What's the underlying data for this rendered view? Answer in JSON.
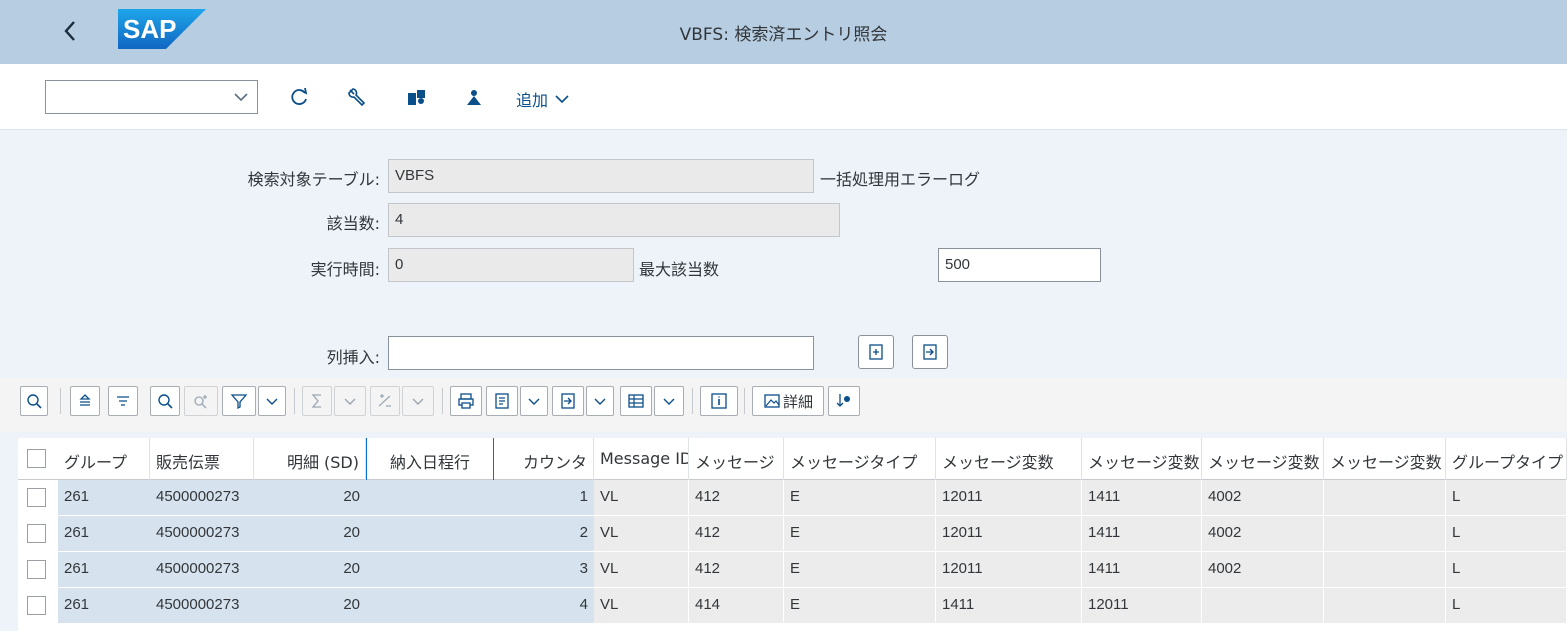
{
  "shell": {
    "title": "VBFS: 検索済エントリ照会",
    "logo_text": "SAP",
    "brand_color": "#1b74c8"
  },
  "toolbar": {
    "command_value": "",
    "icons": [
      "refresh-icon",
      "wrench-icon",
      "puzzle-icon",
      "person-icon"
    ],
    "more_label": "追加"
  },
  "form": {
    "table_label": "検索対象テーブル:",
    "table_value": "VBFS",
    "table_desc": "一括処理用エラーログ",
    "hits_label": "該当数:",
    "hits_value": "4",
    "runtime_label": "実行時間:",
    "runtime_value": "0",
    "max_hits_label": "最大該当数",
    "max_hits_value": "500",
    "insert_col_label": "列挿入:",
    "insert_col_value": ""
  },
  "alv": {
    "details_label": "詳細"
  },
  "grid": {
    "columns": [
      "グループ",
      "販売伝票",
      "明細 (SD)",
      "納入日程行",
      "カウンタ",
      "Message ID",
      "メッセージ",
      "メッセージタイプ",
      "メッセージ変数",
      "メッセージ変数",
      "メッセージ変数",
      "メッセージ変数",
      "グループタイプ"
    ],
    "rows": [
      [
        "261",
        "4500000273",
        "20",
        "",
        "1",
        "VL",
        "412",
        "E",
        "12011",
        "1411",
        "4002",
        "",
        "L"
      ],
      [
        "261",
        "4500000273",
        "20",
        "",
        "2",
        "VL",
        "412",
        "E",
        "12011",
        "1411",
        "4002",
        "",
        "L"
      ],
      [
        "261",
        "4500000273",
        "20",
        "",
        "3",
        "VL",
        "412",
        "E",
        "12011",
        "1411",
        "4002",
        "",
        "L"
      ],
      [
        "261",
        "4500000273",
        "20",
        "",
        "4",
        "VL",
        "414",
        "E",
        "1411",
        "12011",
        "",
        "",
        "L"
      ]
    ]
  }
}
